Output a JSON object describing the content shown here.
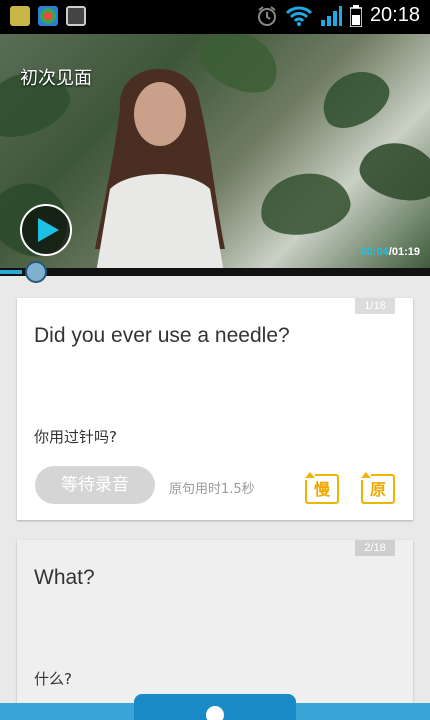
{
  "status_bar": {
    "time": "20:18",
    "icons": [
      "app-notification-icon",
      "flower-app-icon",
      "image-icon",
      "alarm-icon",
      "wifi-icon",
      "signal-icon",
      "battery-icon"
    ]
  },
  "video": {
    "title": "初次见面",
    "current_time": "00:04",
    "total_time": "01:19",
    "progress_fraction": 0.05,
    "accent_color": "#1ec1e6"
  },
  "cards": [
    {
      "counter": "1/18",
      "english": "Did you ever use a needle?",
      "chinese": "你用过针吗?",
      "record_button": "等待录音",
      "duration_text": "原句用时1.5秒",
      "slow_button": "慢",
      "original_button": "原"
    },
    {
      "counter": "2/18",
      "english": "What?",
      "chinese": "什么?"
    }
  ],
  "colors": {
    "progress": "#29a8d9",
    "mini_buttons": "#f0b400",
    "bottom_bar": "#3aa4d6"
  }
}
